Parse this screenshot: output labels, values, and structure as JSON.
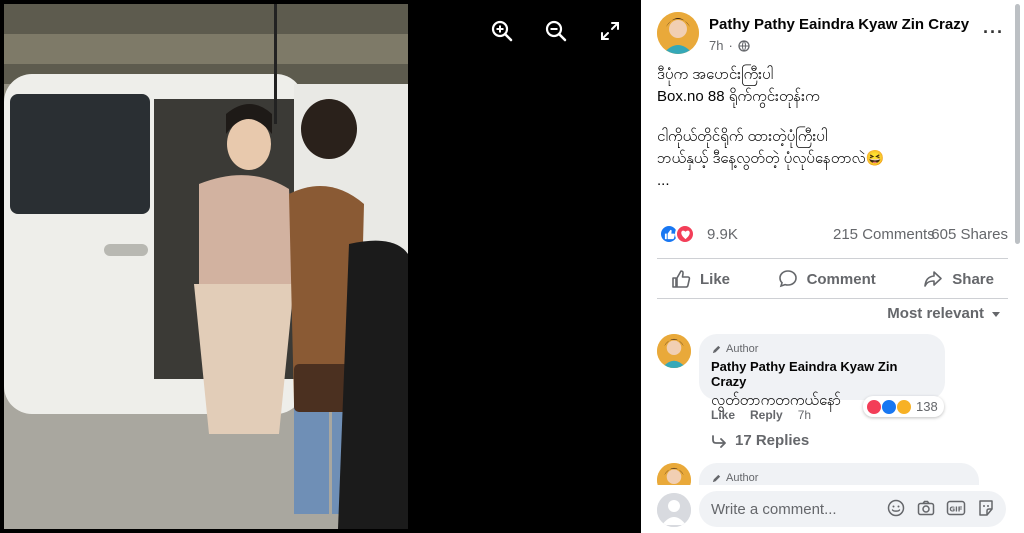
{
  "post": {
    "author": "Pathy Pathy Eaindra Kyaw Zin Crazy",
    "time": "7h",
    "lines": [
      "ဒီပုံက အပောင်းကြီးပါ",
      "Box.no 88 ရိုက်ကွင်းတုန်းက",
      "",
      "ငါကိုယ်တိုင်ရိုက် ထားတဲ့ပုံကြီးပါ",
      "ဘယ်နှယ့် ဒီနေ့လွတ်တဲ့ ပုံလုပ်နေတာလဲ😆",
      "..."
    ]
  },
  "stats": {
    "reactions": "9.9K",
    "comments": "215 Comments",
    "shares": "605 Shares"
  },
  "actions": {
    "like": "Like",
    "comment": "Comment",
    "share": "Share"
  },
  "sort_label": "Most relevant",
  "comments": [
    {
      "tag": "Author",
      "name": "Pathy Pathy Eaindra Kyaw Zin Crazy",
      "text": "လွတ်တာကတကယ်နော်",
      "like": "Like",
      "reply": "Reply",
      "time": "7h",
      "reaction_count": "138",
      "replies": "17 Replies"
    },
    {
      "tag": "Author"
    }
  ],
  "composer": {
    "placeholder": "Write a comment..."
  },
  "colors": {
    "accent": "#1877f2",
    "love": "#f33e58",
    "meta": "#65676b",
    "bubble": "#f0f2f5"
  }
}
